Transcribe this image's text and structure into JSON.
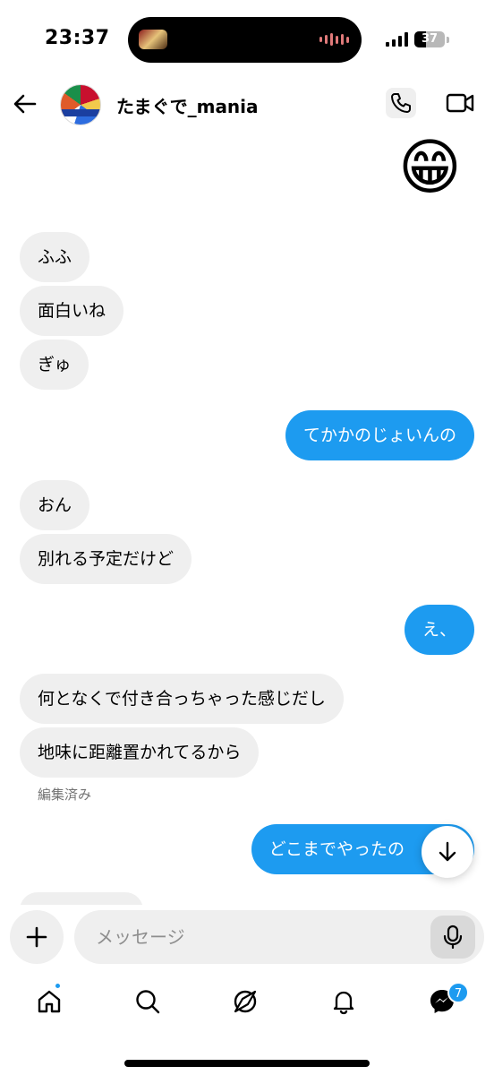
{
  "status_bar": {
    "time": "23:37",
    "battery": "37"
  },
  "header": {
    "username": "たまぐで_mania"
  },
  "emoji_message": "😁",
  "messages": [
    {
      "text": "ふふ",
      "from": "them"
    },
    {
      "text": "面白いね",
      "from": "them"
    },
    {
      "text": "ぎゅ",
      "from": "them"
    },
    {
      "text": "てかかのじょいんの",
      "from": "me"
    },
    {
      "text": "おん",
      "from": "them"
    },
    {
      "text": "別れる予定だけど",
      "from": "them"
    },
    {
      "text": "え、",
      "from": "me"
    },
    {
      "text": "何となくで付き合っちゃった感じだし",
      "from": "them"
    },
    {
      "text": "地味に距離置かれてるから",
      "from": "them"
    },
    {
      "text": "どこまでやったの",
      "from": "me"
    }
  ],
  "edited_label": "編集済み",
  "composer": {
    "placeholder": "メッセージ"
  },
  "nav": {
    "dm_badge": "7"
  },
  "colors": {
    "accent": "#1d9bf0",
    "bubble_in": "#efefef"
  }
}
